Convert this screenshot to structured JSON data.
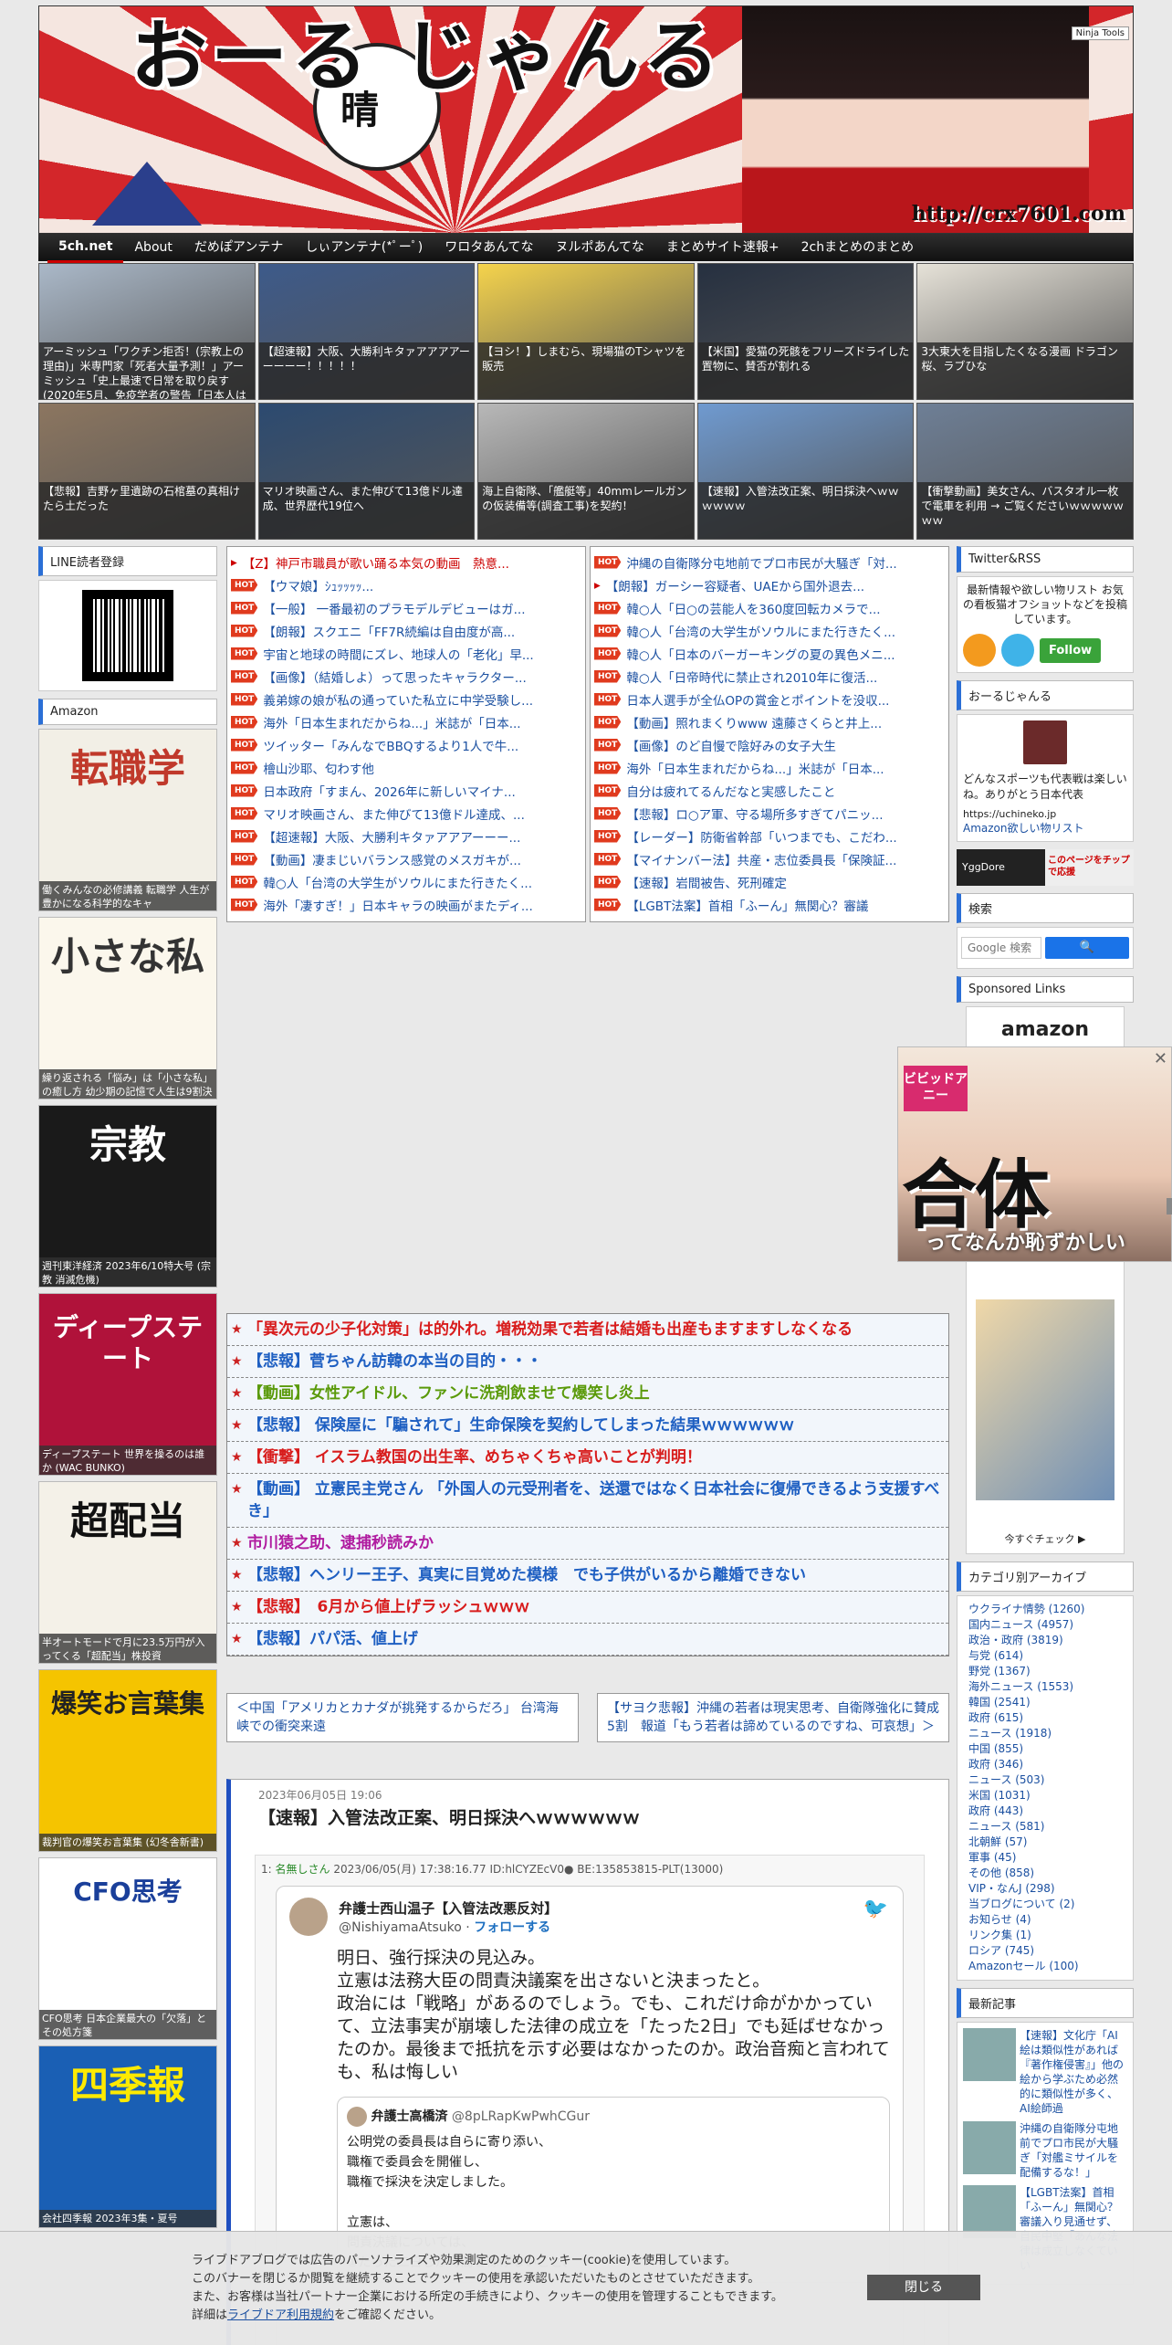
{
  "header": {
    "logo": "おーる じゃんる",
    "fan_text": "晴",
    "url": "http://crx7601.com",
    "ninja": "Ninja Tools"
  },
  "nav": [
    "5ch.net",
    "About",
    "だめぽアンテナ",
    "しぃアンテナ(*ﾟーﾟ)",
    "ワロタあんてな",
    "ヌルポあんてな",
    "まとめサイト速報+",
    "2chまとめのまとめ"
  ],
  "grid": [
    {
      "caption": "アーミッシュ「ワクチン拒否！(宗教上の理由)」米専門家「死者大量予測！」アーミッシュ「史上最速で日常を取り戻す(2020年5月、免疫学者の警告「日本人は",
      "color": "#aab8c8"
    },
    {
      "caption": "【超速報】大阪、大勝利キタァアアアアーーーーー！！！！！",
      "color": "#3d5a8a"
    },
    {
      "caption": "【ヨシ！】しまむら、現場猫のTシャツを販売",
      "color": "#f5d34c"
    },
    {
      "caption": "【米国】愛猫の死骸をフリーズドライした置物に、賛否が割れる",
      "color": "#263040"
    },
    {
      "caption": "3大東大を目指したくなる漫画 ドラゴン桜、ラブひな",
      "color": "#e6e2d8"
    },
    {
      "caption": "【悲報】吉野ヶ里遺跡の石棺墓の真相けたら土だった",
      "color": "#8c7660"
    },
    {
      "caption": "マリオ映画さん、また伸びて13億ドル達成、世界歴代19位へ",
      "color": "#2c4a70"
    },
    {
      "caption": "海上自衛隊、「艦艇等」40mmレールガンの仮装備等(調査工事)を契約！",
      "color": "#b8b8b8"
    },
    {
      "caption": "【速報】入管法改正案、明日採決へｗｗｗｗｗｗ",
      "color": "#6f9ad0"
    },
    {
      "caption": "【衝撃動画】美女さん、バスタオル一枚で電車を利用 → ご覧くださいｗｗｗｗｗｗｗ",
      "color": "#6e7f96"
    }
  ],
  "left": {
    "line_title": "LINE読者登録",
    "amazon_title": "Amazon",
    "books": [
      {
        "title": "働くみんなの必修講義 転職学 人生が豊かになる科学的なキャ",
        "big": "転職学",
        "bg": "#f2efe6",
        "fg": "#c0392b"
      },
      {
        "title": "繰り返される「悩み」は「小さな私」の癒し方 幼少期の記憶で人生は9割決まる",
        "big": "小さな私",
        "bg": "#fbf7ec",
        "fg": "#333"
      },
      {
        "title": "週刊東洋経済 2023年6/10特大号 (宗教 消滅危機)",
        "big": "宗教",
        "bg": "#1a1a1a",
        "fg": "#fff"
      },
      {
        "title": "ディープステート 世界を操るのは誰か (WAC BUNKO)",
        "big": "ディープステート",
        "bg": "#b0123a",
        "fg": "#fff"
      },
      {
        "title": "半オートモードで月に23.5万円が入ってくる「超配当」株投資",
        "big": "超配当",
        "bg": "#f4f1e8",
        "fg": "#111"
      },
      {
        "title": "裁判官の爆笑お言葉集 (幻冬舎新書)",
        "big": "爆笑お言葉集",
        "bg": "#f5c400",
        "fg": "#222"
      },
      {
        "title": "CFO思考 日本企業最大の「欠落」とその処方箋",
        "big": "CFO思考",
        "bg": "#ffffff",
        "fg": "#1a3f9a"
      },
      {
        "title": "会社四季報 2023年3集・夏号",
        "big": "四季報",
        "bg": "#1a5fb4",
        "fg": "#ffea00"
      }
    ]
  },
  "rss_left": [
    {
      "hot": "",
      "text": "【Z】神戸市職員が歌い踊る本気の動画　熱意...",
      "red": true
    },
    {
      "hot": "HOT",
      "text": "【ウマ娘】ｼｭｯｯｯｯ...",
      "red": false
    },
    {
      "hot": "HOT",
      "text": "【一般】 一番最初のプラモデルデビューはガ...",
      "red": false
    },
    {
      "hot": "HOT",
      "text": "【朗報】スクエニ「FF7R続編は自由度が高...",
      "red": false
    },
    {
      "hot": "HOT",
      "text": "宇宙と地球の時間にズレ、地球人の「老化」早...",
      "red": false
    },
    {
      "hot": "HOT",
      "text": "【画像】（結婚しよ）って思ったキャラクター...",
      "red": false
    },
    {
      "hot": "HOT",
      "text": "義弟嫁の娘が私の通っていた私立に中学受験し...",
      "red": false
    },
    {
      "hot": "HOT",
      "text": "海外「日本生まれだからね...」米誌が「日本...",
      "red": false
    },
    {
      "hot": "HOT",
      "text": "ツイッター「みんなでBBQするより1人で牛...",
      "red": false
    },
    {
      "hot": "HOT",
      "text": "檜山沙耶、匂わす他",
      "red": false
    },
    {
      "hot": "HOT",
      "text": "日本政府「すまん、2026年に新しいマイナ...",
      "red": false
    },
    {
      "hot": "HOT",
      "text": "マリオ映画さん、また伸びて13億ドル達成、...",
      "red": false
    },
    {
      "hot": "HOT",
      "text": "【超速報】大阪、大勝利キタァアアアーーー...",
      "red": false
    },
    {
      "hot": "HOT",
      "text": "【動画】凄まじいバランス感覚のメスガキが...",
      "red": false
    },
    {
      "hot": "HOT",
      "text": "韓○人「台湾の大学生がソウルにまた行きたく...",
      "red": false
    },
    {
      "hot": "HOT",
      "text": "海外「凄すぎ！」日本キャラの映画がまたディ...",
      "red": false
    }
  ],
  "rss_right": [
    {
      "hot": "HOT",
      "text": "沖縄の自衛隊分屯地前でプロ市民が大騒ぎ「対...",
      "red": false
    },
    {
      "hot": "",
      "text": "【朗報】ガーシー容疑者、UAEから国外退去...",
      "red": false
    },
    {
      "hot": "HOT",
      "text": "韓○人「日○の芸能人を360度回転カメラで...",
      "red": false
    },
    {
      "hot": "HOT",
      "text": "韓○人「台湾の大学生がソウルにまた行きたく...",
      "red": false
    },
    {
      "hot": "HOT",
      "text": "韓○人「日本のバーガーキングの夏の異色メニ...",
      "red": false
    },
    {
      "hot": "HOT",
      "text": "韓○人「日帝時代に禁止され2010年に復活...",
      "red": false
    },
    {
      "hot": "HOT",
      "text": "日本人選手が全仏OPの賞金とポイントを没収...",
      "red": false
    },
    {
      "hot": "HOT",
      "text": "【動画】照れまくりwww 遠藤さくらと井上...",
      "red": false
    },
    {
      "hot": "HOT",
      "text": "【画像】のど自慢で陰好みの女子大生",
      "red": false
    },
    {
      "hot": "HOT",
      "text": "海外「日本生まれだからね...」米誌が「日本...",
      "red": false
    },
    {
      "hot": "HOT",
      "text": "自分は疲れてるんだなと実感したこと",
      "red": false
    },
    {
      "hot": "HOT",
      "text": "【悲報】ロ○ア軍、守る場所多すぎてパニッ...",
      "red": false
    },
    {
      "hot": "HOT",
      "text": "【レーダー】防衛省幹部「いつまでも、こだわ...",
      "red": false
    },
    {
      "hot": "HOT",
      "text": "【マイナンバー法】共産・志位委員長「保険証...",
      "red": false
    },
    {
      "hot": "HOT",
      "text": "【速報】岩間被告、死刑確定",
      "red": false
    },
    {
      "hot": "HOT",
      "text": "【LGBT法案】首相「ふーん」無関心？審議",
      "red": false
    }
  ],
  "headlines": [
    {
      "text": "「異次元の少子化対策」は的外れ。増税効果で若者は結婚も出産もますますしなくなる",
      "color": "#d81c1c"
    },
    {
      "text": "【悲報】菅ちゃん訪韓の本当の目的・・・",
      "color": "#1e5fc2"
    },
    {
      "text": "【動画】女性アイドル、ファンに洗剤飲ませて爆笑し炎上",
      "color": "#5a9a0a"
    },
    {
      "text": "【悲報】 保険屋に「騙されて」生命保険を契約してしまった結果ｗｗｗｗｗｗ",
      "color": "#1e5fc2"
    },
    {
      "text": "【衝撃】 イスラム教国の出生率、めちゃくちゃ高いことが判明！",
      "color": "#d81c1c"
    },
    {
      "text": "【動画】 立憲民主党さん 「外国人の元受刑者を、送還ではなく日本社会に復帰できるよう支援すべき」",
      "color": "#1e5fc2"
    },
    {
      "text": "市川猿之助、逮捕秒読みか",
      "color": "#b01ca0"
    },
    {
      "text": "【悲報】ヘンリー王子、真実に目覚めた模様　でも子供がいるから離婚できない",
      "color": "#1e5fc2"
    },
    {
      "text": "【悲報】　6月から値上げラッシュｗｗｗ",
      "color": "#d81c1c"
    },
    {
      "text": "【悲報】パパ活、値上げ",
      "color": "#1e5fc2"
    }
  ],
  "prev": "＜中国「アメリカとカナダが挑発するからだろ」 台湾海峡での衝突来遠",
  "next": "【サヨク悲報】沖縄の若者は現実思考、自衛隊強化に賛成5割　報道「もう若者は諦めているのですね、可哀想」＞",
  "article": {
    "date": "2023年06月05日 19:06",
    "title": "【速報】入管法改正案、明日採決へｗｗｗｗｗｗ",
    "post_meta_num": "1:",
    "post_meta_name": "名無しさん",
    "post_meta_rest": "2023/06/05(月) 17:38:16.77 ID:hlCYZEcV0● BE:135853815-PLT(13000)",
    "tweet_name": "弁護士西山温子【入管法改悪反対】",
    "tweet_handle": "@NishiyamaAtsuko",
    "tweet_follow": "フォローする",
    "tweet_body": "明日、強行採決の見込み。\n立憲は法務大臣の問責決議案を出さないと決まったと。\n政治には「戦略」があるのでしょう。でも、これだけ命がかかっていて、立法事実が崩壊した法律の成立を「たった2日」でも延ばせなかったのか。最後まで抵抗を示す必要はなかったのか。政治音痴と言われても、私は悔しい",
    "quote_name": "弁護士高橋済",
    "quote_handle": "@8pLRapKwPwhCGur",
    "quote_body": "公明党の委員長は自らに寄り添い、\n職権で委員会を開催し、\n職権で採決を決定しました。\n\n立憲は、\n問責決議については、\n①たった二日しか時間を稼げないこと、"
  },
  "right": {
    "twitter_title": "Twitter&RSS",
    "twitter_text": "最新情報や欲しい物リスト お気の看板猫オフショットなどを投稿しています。",
    "follow": "Follow",
    "profile_title": "おーるじゃんる",
    "profile_text": "どんなスポーツも代表戦は楽しいね。ありがとう日本代表",
    "profile_link1": "https://uchineko.jp",
    "profile_link2": "Amazon欲しい物リスト",
    "yggdore": "YggDore",
    "yggdore_tip": "このページをチップで応援",
    "search_title": "検索",
    "search_placeholder": "Google 検索",
    "sponsored_title": "Sponsored Links",
    "amazon_label": "amazon",
    "amazon_check": "今すぐチェック ▶",
    "category_title": "カテゴリ別アーカイブ",
    "categories": [
      "ウクライナ情勢 (1260)",
      "国内ニュース (4957)",
      "政治・政府 (3819)",
      "与党 (614)",
      "野党 (1367)",
      "海外ニュース (1553)",
      "韓国 (2541)",
      "政府 (615)",
      "ニュース (1918)",
      "中国 (855)",
      "政府 (346)",
      "ニュース (503)",
      "米国 (1031)",
      "政府 (443)",
      "ニュース (581)",
      "北朝鮮 (57)",
      "軍事 (45)",
      "その他 (858)",
      "VIP・なんJ (298)",
      "当ブログについて (2)",
      "お知らせ (4)",
      "リンク集 (1)",
      "ロシア (745)",
      "Amazonセール (100)"
    ],
    "recent_title": "最新記事",
    "recent": [
      "【速報】文化庁「AI絵は類似性があれば『著作権侵害』」他の絵から学ぶため必然的に類似性が多く、AI絵師過",
      "沖縄の自衛隊分屯地前でプロ市民が大騒ぎ「対艦ミサイルを配備するな！」",
      "【LGBT法案】首相「ふーん」無関心？審議入り見通せず、自民中堅「あんな法律は成立しなくていい"
    ]
  },
  "popup": {
    "tag": "ビビッドアニー",
    "big": "合体",
    "sub": "ってなんか恥ずかしい"
  },
  "cookie": {
    "line1": "ライブドアブログでは広告のパーソナライズや効果測定のためのクッキー(cookie)を使用しています。",
    "line2": "このバナーを閉じるか閲覧を継続することでクッキーの使用を承認いただいたものとさせていただきます。",
    "line3": "また、お客様は当社パートナー企業における所定の手続きにより、クッキーの使用を管理することもできます。",
    "line4_pre": "詳細は",
    "line4_link": "ライブドア利用規約",
    "line4_post": "をご確認ください。",
    "close": "閉じる"
  }
}
